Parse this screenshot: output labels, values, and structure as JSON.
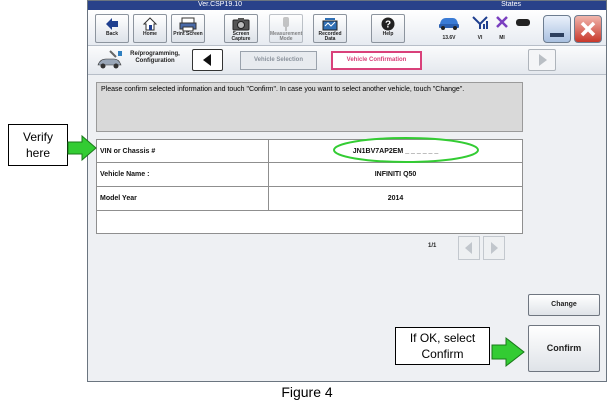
{
  "window": {
    "title_left": "Ver.CSP19.10",
    "title_right": "States"
  },
  "toolbar": {
    "buttons": [
      {
        "label": "Back",
        "icon": "back-arrow-icon"
      },
      {
        "label": "Home",
        "icon": "home-icon"
      },
      {
        "label": "Print Screen",
        "icon": "printer-icon"
      },
      {
        "label": "Screen Capture",
        "icon": "camera-icon"
      },
      {
        "label": "Measurement Mode",
        "icon": "measurement-icon"
      },
      {
        "label": "Recorded Data",
        "icon": "recorded-data-icon"
      },
      {
        "label": "Help",
        "icon": "help-icon"
      }
    ],
    "status": [
      {
        "label": "13.6V",
        "icon": "car-battery-icon"
      },
      {
        "label": "VI",
        "icon": "vi-signal-icon"
      },
      {
        "label": "MI",
        "icon": "mi-disconnected-icon"
      }
    ]
  },
  "nav": {
    "section_label": "Re/programming, Configuration",
    "steps": [
      "Vehicle Selection",
      "Vehicle Confirmation"
    ],
    "active_step": "Vehicle Confirmation"
  },
  "message": "Please confirm selected information and touch \"Confirm\". In case you want to select another vehicle, touch \"Change\".",
  "table": {
    "rows": [
      {
        "label": "VIN or Chassis #",
        "value": "JN1BV7AP2EM _ _ _ _ _ _"
      },
      {
        "label": "Vehicle Name :",
        "value": "INFINITI Q50"
      },
      {
        "label": "Model Year",
        "value": "2014"
      }
    ]
  },
  "pager": {
    "page": "1/1"
  },
  "buttons": {
    "change": "Change",
    "confirm": "Confirm"
  },
  "annotations": {
    "verify_line1": "Verify",
    "verify_line2": "here",
    "ok_line1": "If OK, select",
    "ok_line2": "Confirm",
    "arrow_color": "#33cc33",
    "highlight_color": "#33cc33"
  },
  "caption": "Figure 4"
}
